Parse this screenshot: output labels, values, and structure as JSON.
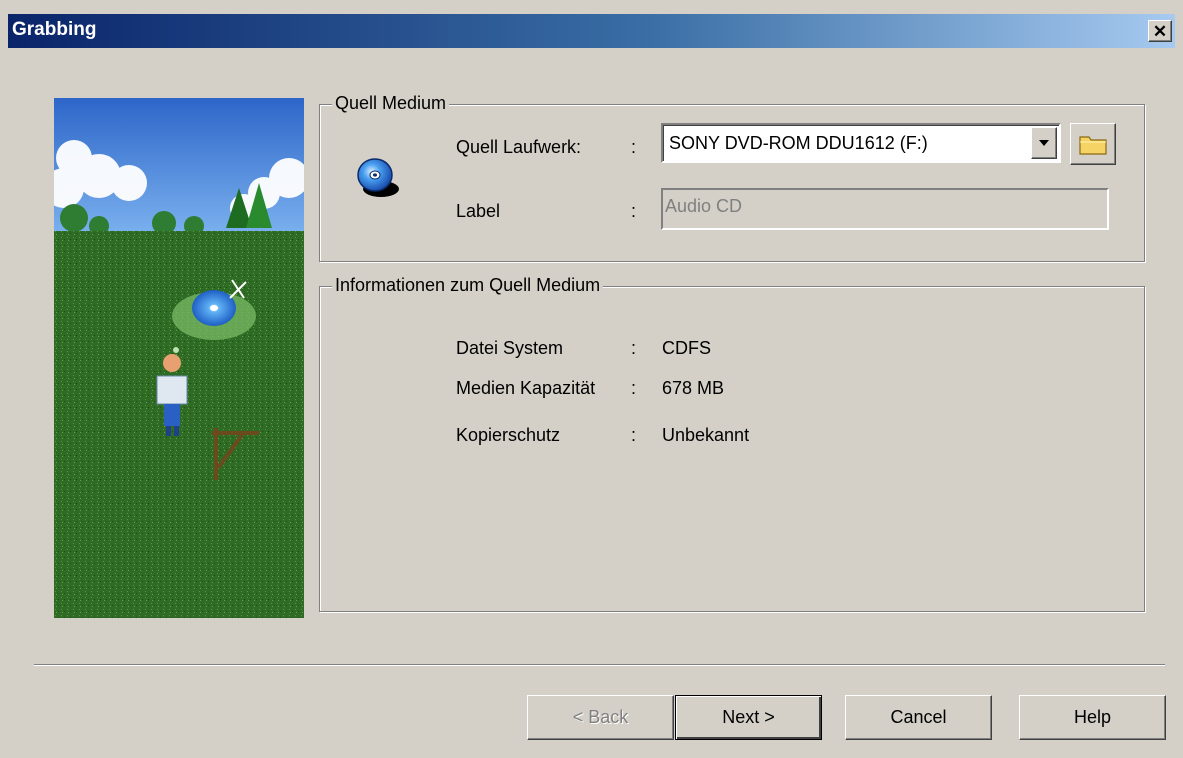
{
  "window": {
    "title": "Grabbing",
    "close_glyph": "✕"
  },
  "source_group": {
    "legend": "Quell Medium",
    "icon": "cd-drive-icon",
    "drive_label": "Quell Laufwerk:",
    "drive_colon": ":",
    "drive_value": "SONY DVD-ROM DDU1612 (F:)",
    "browse_icon": "folder-icon",
    "label_label": "Label",
    "label_colon": ":",
    "label_value": "Audio CD"
  },
  "info_group": {
    "legend": "Informationen zum Quell Medium",
    "rows": [
      {
        "key": "Datei System",
        "sep": ":",
        "value": "CDFS"
      },
      {
        "key": "Medien Kapazität",
        "sep": ":",
        "value": "678 MB"
      },
      {
        "key": "Kopierschutz",
        "sep": ":",
        "value": "Unbekannt"
      }
    ]
  },
  "buttons": {
    "back": "< Back",
    "next": "Next >",
    "cancel": "Cancel",
    "help": "Help"
  }
}
